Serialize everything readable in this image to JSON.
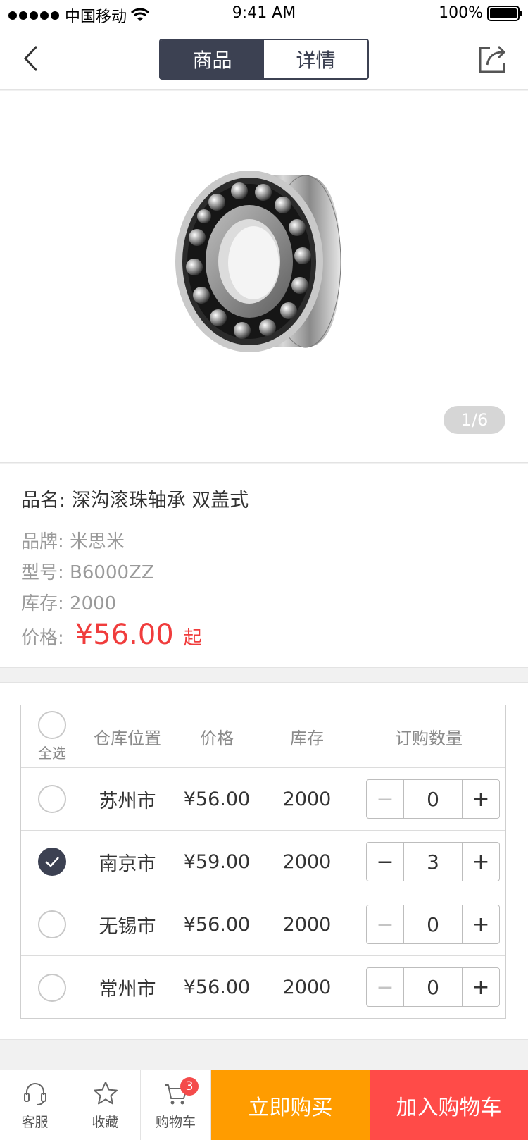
{
  "status_bar": {
    "carrier": "中国移动",
    "time": "9:41 AM",
    "battery": "100%"
  },
  "nav": {
    "tabs": [
      {
        "label": "商品",
        "active": true
      },
      {
        "label": "详情",
        "active": false
      }
    ]
  },
  "carousel": {
    "pager": "1/6"
  },
  "product": {
    "name_label": "品名:",
    "name": "深沟滚珠轴承 双盖式",
    "brand_label": "品牌:",
    "brand": "米思米",
    "model_label": "型号:",
    "model": "B6000ZZ",
    "stock_label": "库存:",
    "stock": "2000",
    "price_label": "价格:",
    "price": "¥56.00",
    "price_suffix": "起"
  },
  "table": {
    "headers": {
      "select_all": "全选",
      "location": "仓库位置",
      "price": "价格",
      "stock": "库存",
      "quantity": "订购数量"
    },
    "rows": [
      {
        "location": "苏州市",
        "price": "¥56.00",
        "stock": "2000",
        "quantity": "0",
        "checked": false
      },
      {
        "location": "南京市",
        "price": "¥59.00",
        "stock": "2000",
        "quantity": "3",
        "checked": true
      },
      {
        "location": "无锡市",
        "price": "¥56.00",
        "stock": "2000",
        "quantity": "0",
        "checked": false
      },
      {
        "location": "常州市",
        "price": "¥56.00",
        "stock": "2000",
        "quantity": "0",
        "checked": false
      }
    ],
    "minus": "−",
    "plus": "+"
  },
  "bottom_bar": {
    "service_label": "客服",
    "favorite_label": "收藏",
    "cart_label": "购物车",
    "cart_count": "3",
    "buy_now": "立即购买",
    "add_to_cart": "加入购物车"
  },
  "colors": {
    "primary_dark": "#3c4152",
    "price_red": "#f03c3c",
    "buy_orange": "#ff9c00",
    "cart_red": "#ff4b48"
  },
  "icons": [
    "back-icon",
    "share-icon",
    "headset-icon",
    "star-icon",
    "cart-icon",
    "check-icon",
    "wifi-icon"
  ]
}
